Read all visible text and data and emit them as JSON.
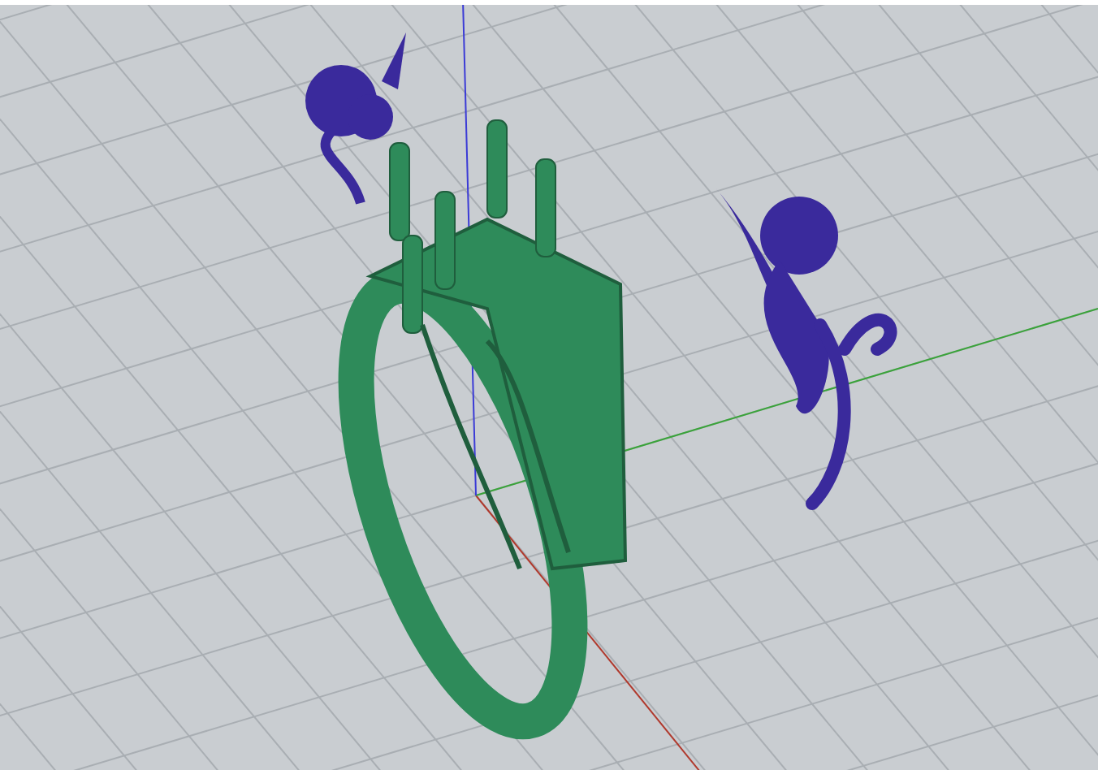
{
  "viewport": {
    "axes": [
      {
        "kind": "x",
        "color": "#b03a2e"
      },
      {
        "kind": "y",
        "color": "#3aa33a"
      },
      {
        "kind": "z",
        "color": "#3b3bd6"
      }
    ],
    "models": [
      {
        "kind": "ring",
        "color": "#2e8b5a"
      },
      {
        "kind": "flower-left",
        "color": "#3a2a9c"
      },
      {
        "kind": "flower-right",
        "color": "#3a2a9c"
      }
    ]
  }
}
